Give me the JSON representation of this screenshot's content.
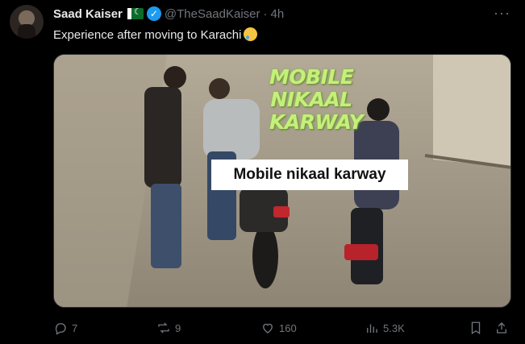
{
  "tweet": {
    "author_name": "Saad Kaiser",
    "handle": "@TheSaadKaiser",
    "separator": "·",
    "time": "4h",
    "text": "Experience after moving to Karachi",
    "more_label": "···"
  },
  "media": {
    "caption_top": "MOBILE NIKAAL KARWAY",
    "caption_box": "Mobile nikaal karway"
  },
  "actions": {
    "replies": "7",
    "reposts": "9",
    "likes": "160",
    "views": "5.3K"
  },
  "colors": {
    "background": "#000000",
    "text": "#e7e9ea",
    "muted": "#71767b",
    "verified": "#1d9bf0",
    "caption_green": "#c4f07a"
  },
  "icons": [
    "flag-pakistan-icon",
    "verified-badge-icon",
    "more-icon",
    "crying-face-emoji-icon",
    "reply-icon",
    "repost-icon",
    "like-icon",
    "views-icon",
    "bookmark-icon",
    "share-icon"
  ]
}
